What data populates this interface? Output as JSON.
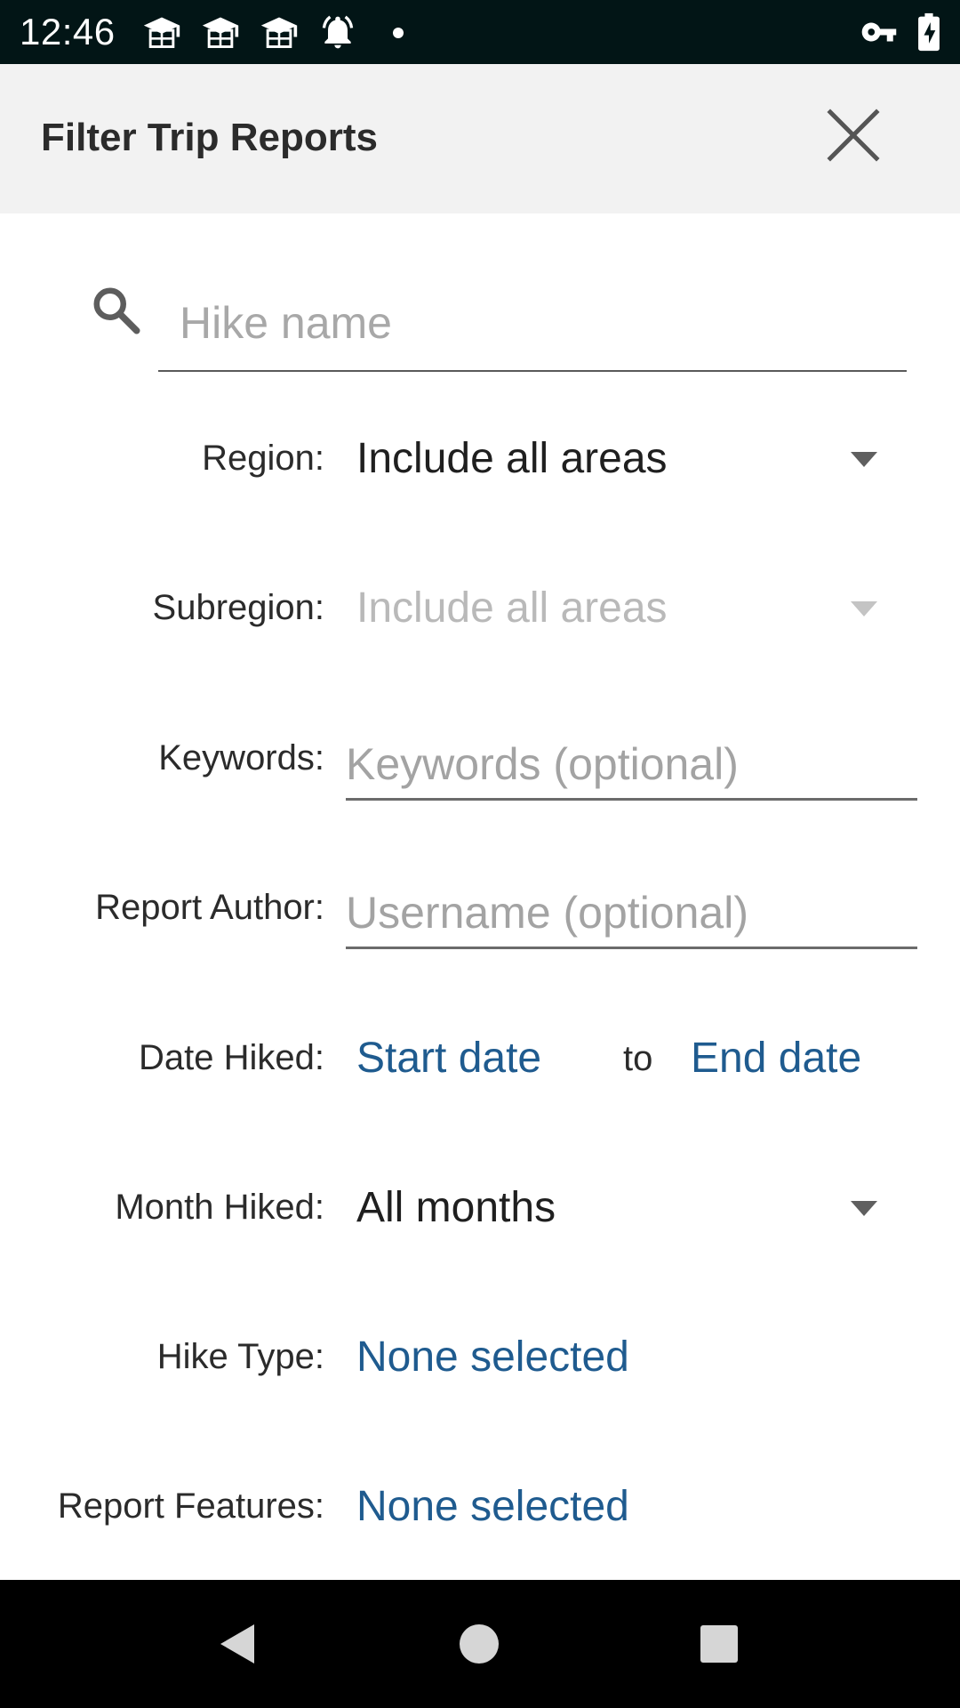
{
  "status_bar": {
    "time": "12:46",
    "icons": [
      "graduation-cap-icon",
      "graduation-cap-icon",
      "graduation-cap-icon",
      "alarm-bell-icon",
      "notification-dot",
      "vpn-key-icon",
      "battery-charging-icon"
    ]
  },
  "header": {
    "title": "Filter Trip Reports",
    "close_icon": "close-icon"
  },
  "search": {
    "placeholder": "Hike name",
    "value": ""
  },
  "filters": {
    "region": {
      "label": "Region:",
      "value": "Include all areas"
    },
    "subregion": {
      "label": "Subregion:",
      "value": "Include all areas"
    },
    "keywords": {
      "label": "Keywords:",
      "placeholder": "Keywords (optional)",
      "value": ""
    },
    "report_author": {
      "label": "Report Author:",
      "placeholder": "Username (optional)",
      "value": ""
    },
    "date_hiked": {
      "label": "Date Hiked:",
      "start": "Start date",
      "to": "to",
      "end": "End date"
    },
    "month_hiked": {
      "label": "Month Hiked:",
      "value": "All months"
    },
    "hike_type": {
      "label": "Hike Type:",
      "value": "None selected"
    },
    "report_features": {
      "label": "Report Features:",
      "value": "None selected"
    }
  },
  "nav_bar": {
    "buttons": [
      "back-icon",
      "home-icon",
      "recents-icon"
    ]
  },
  "colors": {
    "status_bar_bg": "#021516",
    "header_bg": "#f2f2f2",
    "link": "#1f5b8f",
    "nav_bar_bg": "#000000"
  }
}
